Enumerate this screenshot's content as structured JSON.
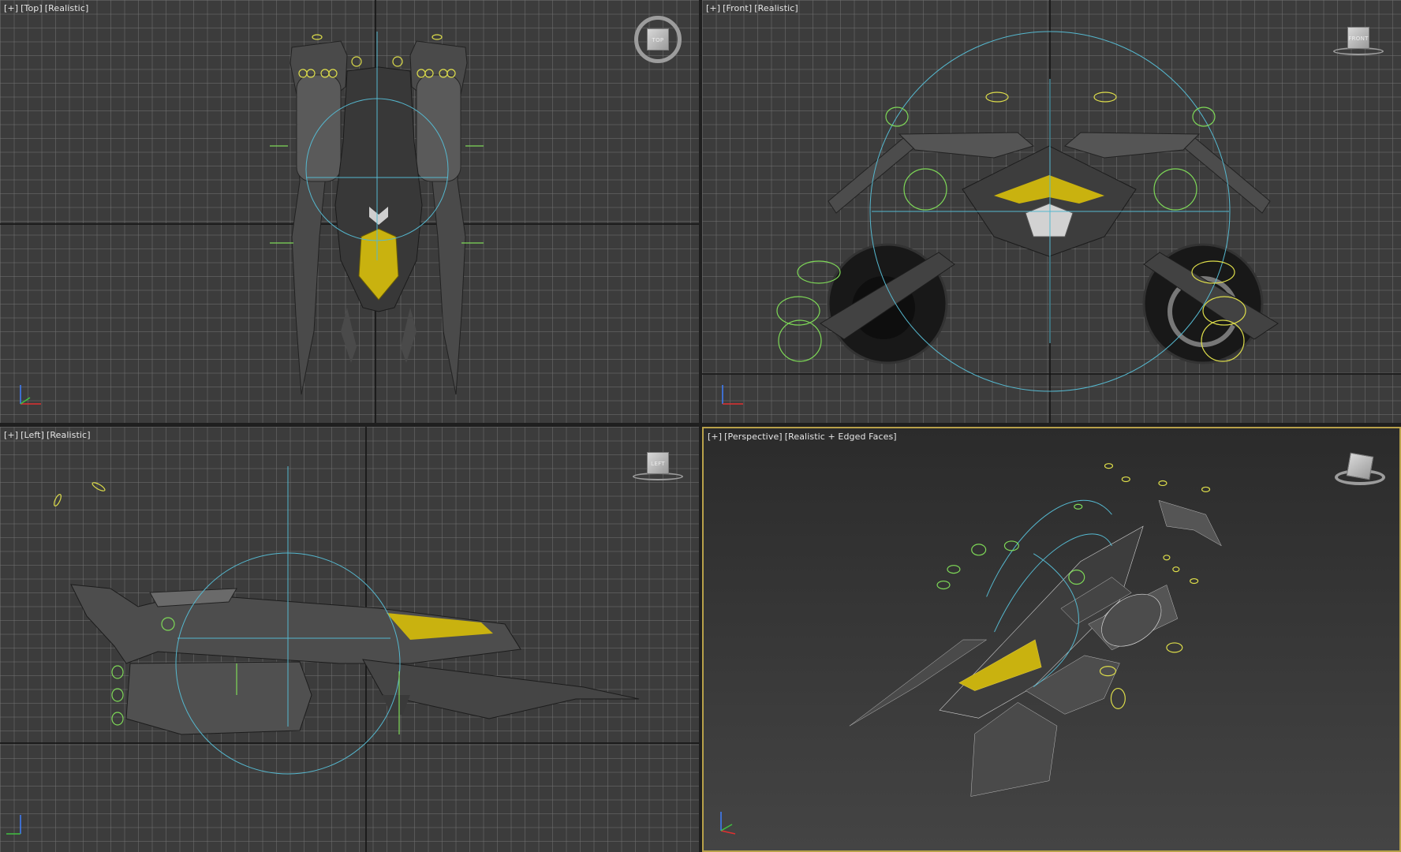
{
  "viewports": {
    "top": {
      "label": {
        "plus": "[+]",
        "view": "[Top]",
        "shading": "[Realistic]"
      },
      "viewcube_face": "TOP"
    },
    "front": {
      "label": {
        "plus": "[+]",
        "view": "[Front]",
        "shading": "[Realistic]"
      },
      "viewcube_face": "FRONT"
    },
    "left": {
      "label": {
        "plus": "[+]",
        "view": "[Left]",
        "shading": "[Realistic]"
      },
      "viewcube_face": "LEFT"
    },
    "perspective": {
      "label": {
        "plus": "[+]",
        "view": "[Perspective]",
        "shading": "[Realistic + Edged Faces]"
      },
      "viewcube_face": ""
    }
  },
  "colors": {
    "viewport_bg": "#3c3c3c",
    "grid": "#6f6f6f",
    "home_grid_axis": "#101010",
    "active_border": "#b8a14a",
    "bone_cyan": "#55b8cf",
    "helper_green": "#7ed957",
    "helper_yellow": "#dede4a",
    "hull_accent": "#c9b20f",
    "hull_dark": "#3a3a3a"
  },
  "icons": [
    "viewcube-icon",
    "steering-wheel-ring-icon",
    "axis-tripod-icon"
  ]
}
